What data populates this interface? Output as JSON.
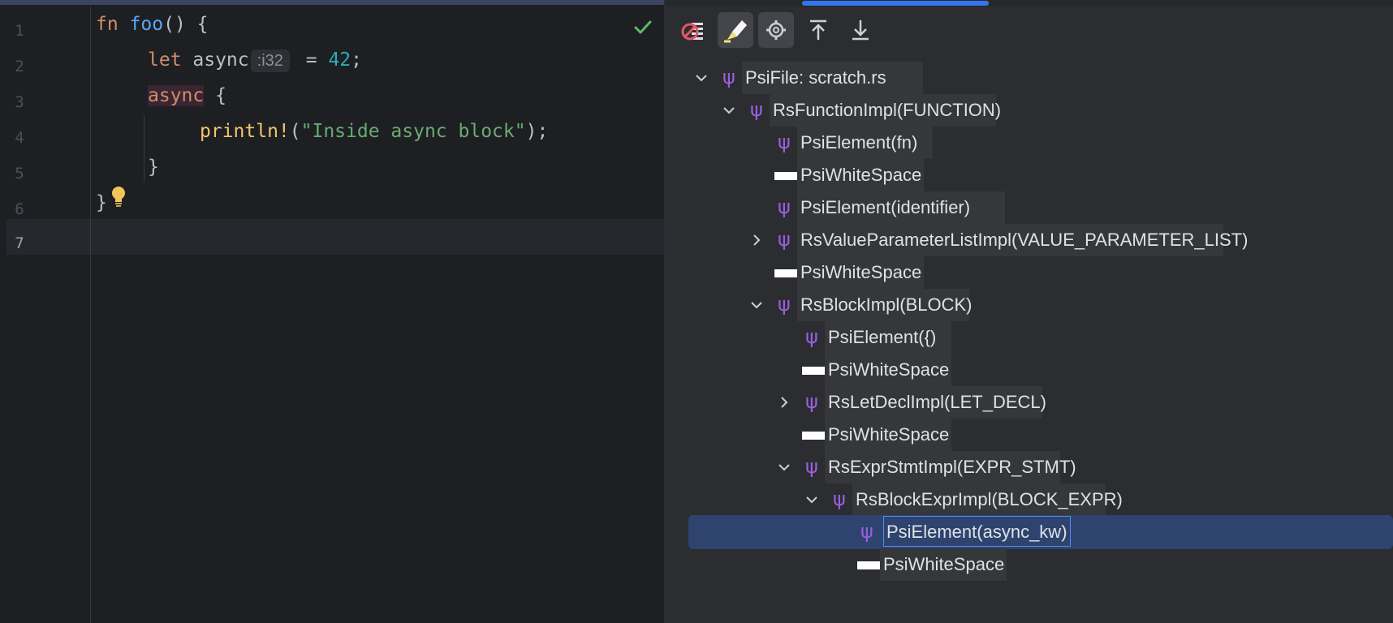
{
  "editor": {
    "line_numbers": [
      "1",
      "2",
      "3",
      "4",
      "5",
      "6",
      "7"
    ],
    "current_line": "7",
    "code": {
      "l1_kw": "fn",
      "l1_fn": "foo",
      "l1_rest": "() {",
      "l2_kw": "let",
      "l2_ident": " async",
      "l2_hint": ":i32",
      "l2_eq": " = ",
      "l2_num": "42",
      "l2_semi": ";",
      "l3_kw": "async",
      "l3_rest": " {",
      "l4_macro": "println!",
      "l4_open": "(",
      "l4_str": "\"Inside async block\"",
      "l4_close": ");",
      "l5": "}",
      "l6": "}"
    },
    "status_icon": "check-icon",
    "intention_icon": "lightbulb-icon",
    "colors": {
      "keyword": "#cf8e6d",
      "function": "#56a8f5",
      "number": "#2aacb8",
      "macro": "#f0c76e",
      "string": "#6aab73"
    }
  },
  "psi_viewer": {
    "toolbar": [
      {
        "name": "no-highlight-icon"
      },
      {
        "name": "highlight-brush-icon",
        "active": true
      },
      {
        "name": "settings-gear-icon",
        "active": true
      },
      {
        "name": "scroll-to-top-icon"
      },
      {
        "name": "scroll-to-bottom-icon"
      }
    ],
    "tree": [
      {
        "label": "PsiFile: scratch.rs",
        "level": 0,
        "expander": "expanded",
        "icon": "psi-icon"
      },
      {
        "label": "RsFunctionImpl(FUNCTION)",
        "level": 1,
        "expander": "expanded",
        "icon": "psi-icon"
      },
      {
        "label": "PsiElement(fn)",
        "level": 2,
        "expander": "none",
        "icon": "psi-icon"
      },
      {
        "label": "PsiWhiteSpace",
        "level": 2,
        "expander": "none",
        "icon": "whitespace-icon"
      },
      {
        "label": "PsiElement(identifier)",
        "level": 2,
        "expander": "none",
        "icon": "psi-icon"
      },
      {
        "label": "RsValueParameterListImpl(VALUE_PARAMETER_LIST)",
        "level": 2,
        "expander": "collapsed",
        "icon": "psi-icon"
      },
      {
        "label": "PsiWhiteSpace",
        "level": 2,
        "expander": "none",
        "icon": "whitespace-icon"
      },
      {
        "label": "RsBlockImpl(BLOCK)",
        "level": 2,
        "expander": "expanded",
        "icon": "psi-icon"
      },
      {
        "label": "PsiElement({)",
        "level": 3,
        "expander": "none",
        "icon": "psi-icon"
      },
      {
        "label": "PsiWhiteSpace",
        "level": 3,
        "expander": "none",
        "icon": "whitespace-icon"
      },
      {
        "label": "RsLetDeclImpl(LET_DECL)",
        "level": 3,
        "expander": "collapsed",
        "icon": "psi-icon"
      },
      {
        "label": "PsiWhiteSpace",
        "level": 3,
        "expander": "none",
        "icon": "whitespace-icon"
      },
      {
        "label": "RsExprStmtImpl(EXPR_STMT)",
        "level": 3,
        "expander": "expanded",
        "icon": "psi-icon"
      },
      {
        "label": "RsBlockExprImpl(BLOCK_EXPR)",
        "level": 4,
        "expander": "expanded",
        "icon": "psi-icon"
      },
      {
        "label": "PsiElement(async_kw)",
        "level": 5,
        "expander": "none",
        "icon": "psi-icon",
        "selected": true
      },
      {
        "label": "PsiWhiteSpace",
        "level": 5,
        "expander": "none",
        "icon": "whitespace-icon"
      }
    ],
    "colors": {
      "psi_icon": "#9b5fe0",
      "selection": "#2e436e",
      "selection_border": "#548af7"
    }
  }
}
